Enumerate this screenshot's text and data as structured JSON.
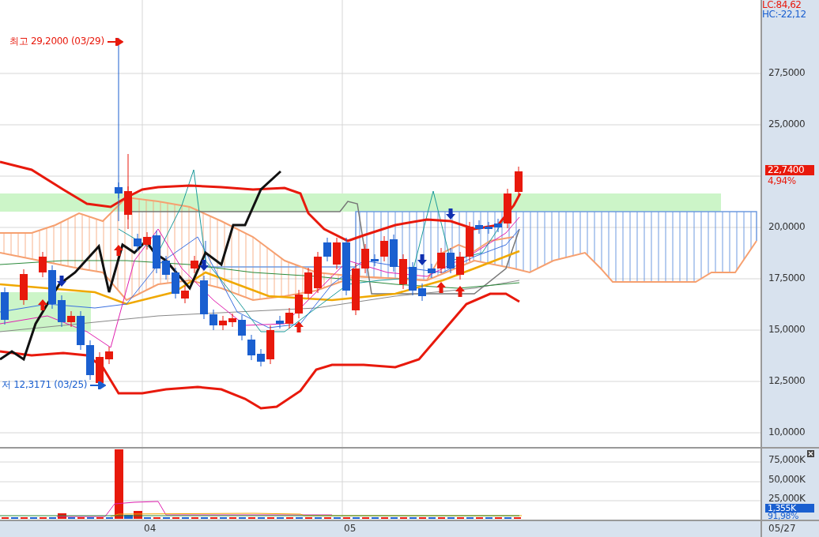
{
  "indicators": [
    {
      "text": "LC:84,62",
      "color": "#e8190c"
    },
    {
      "text": "HC:-22,12",
      "color": "#1a5fd0"
    }
  ],
  "annotations": [
    {
      "kind": "high",
      "text": "최고 29,2000 (03/29)"
    },
    {
      "kind": "low",
      "text": "저 12,3171 (03/25)"
    }
  ],
  "price_axis": {
    "ticks": [
      "27,5000",
      "25,0000",
      "20,0000",
      "17,5000",
      "15,0000",
      "12,5000",
      "10,0000"
    ],
    "current": "22,7400",
    "change": "4,94%"
  },
  "volume_axis": {
    "ticks": [
      "75,000K",
      "50,000K",
      "25,000K"
    ],
    "current": "1,355K",
    "ratio": "91,98%"
  },
  "date_axis": {
    "labels": [
      "04",
      "05"
    ],
    "last_date": "05/27"
  }
}
